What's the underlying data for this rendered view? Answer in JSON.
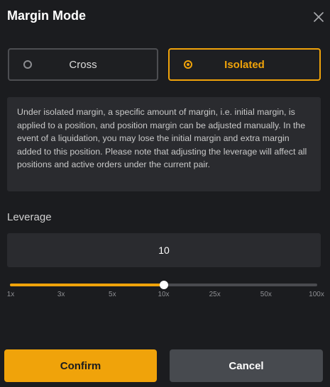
{
  "dialog": {
    "title": "Margin Mode"
  },
  "modes": {
    "cross_label": "Cross",
    "isolated_label": "Isolated",
    "selected": "Isolated"
  },
  "info_text": "Under isolated margin, a specific amount of margin, i.e. initial margin, is applied to a position, and position margin can be adjusted manually. In the event of a liquidation, you may lose the initial margin and extra margin added to this position. Please note that adjusting the leverage will affect all positions and active orders under the current pair.",
  "leverage": {
    "label": "Leverage",
    "value": "10",
    "slider_fraction": 0.5,
    "ticks": [
      "1x",
      "3x",
      "5x",
      "10x",
      "25x",
      "50x",
      "100x"
    ]
  },
  "actions": {
    "confirm_label": "Confirm",
    "cancel_label": "Cancel"
  },
  "colors": {
    "accent": "#f0a30a",
    "background": "#1b1c1f",
    "panel": "#2a2b2f"
  },
  "icons": {
    "close": "close-icon",
    "radio_on": "radio-selected-icon",
    "radio_off": "radio-unselected-icon"
  }
}
